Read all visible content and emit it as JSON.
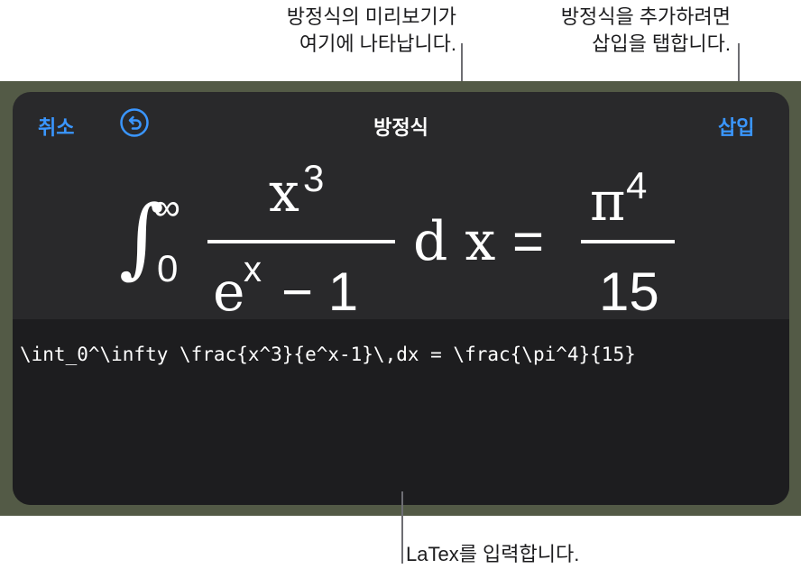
{
  "callouts": {
    "preview_line1": "방정식의 미리보기가",
    "preview_line2": "여기에 나타납니다.",
    "insert_line1": "방정식을 추가하려면",
    "insert_line2": "삽입을 탭합니다.",
    "latex": "LaTex를 입력합니다."
  },
  "toolbar": {
    "cancel_label": "취소",
    "title": "방정식",
    "insert_label": "삽입",
    "undo_icon": "undo-icon"
  },
  "equation": {
    "integral": "∫",
    "upper_limit": "∞",
    "lower_limit": "0",
    "numerator_base": "x",
    "numerator_exp": "3",
    "denominator_base": "e",
    "denominator_exp": "x",
    "denominator_rest": "− 1",
    "differential": "d x",
    "equals": "=",
    "rhs_numerator_base": "π",
    "rhs_numerator_exp": "4",
    "rhs_denominator": "15"
  },
  "editor": {
    "value": "\\int_0^\\infty \\frac{x^3}{e^x-1}\\,dx = \\frac{\\pi^4}{15}"
  },
  "colors": {
    "accent": "#3a96ff",
    "panel": "#29292b",
    "editor": "#1d1d1f",
    "backdrop": "#535a46"
  }
}
